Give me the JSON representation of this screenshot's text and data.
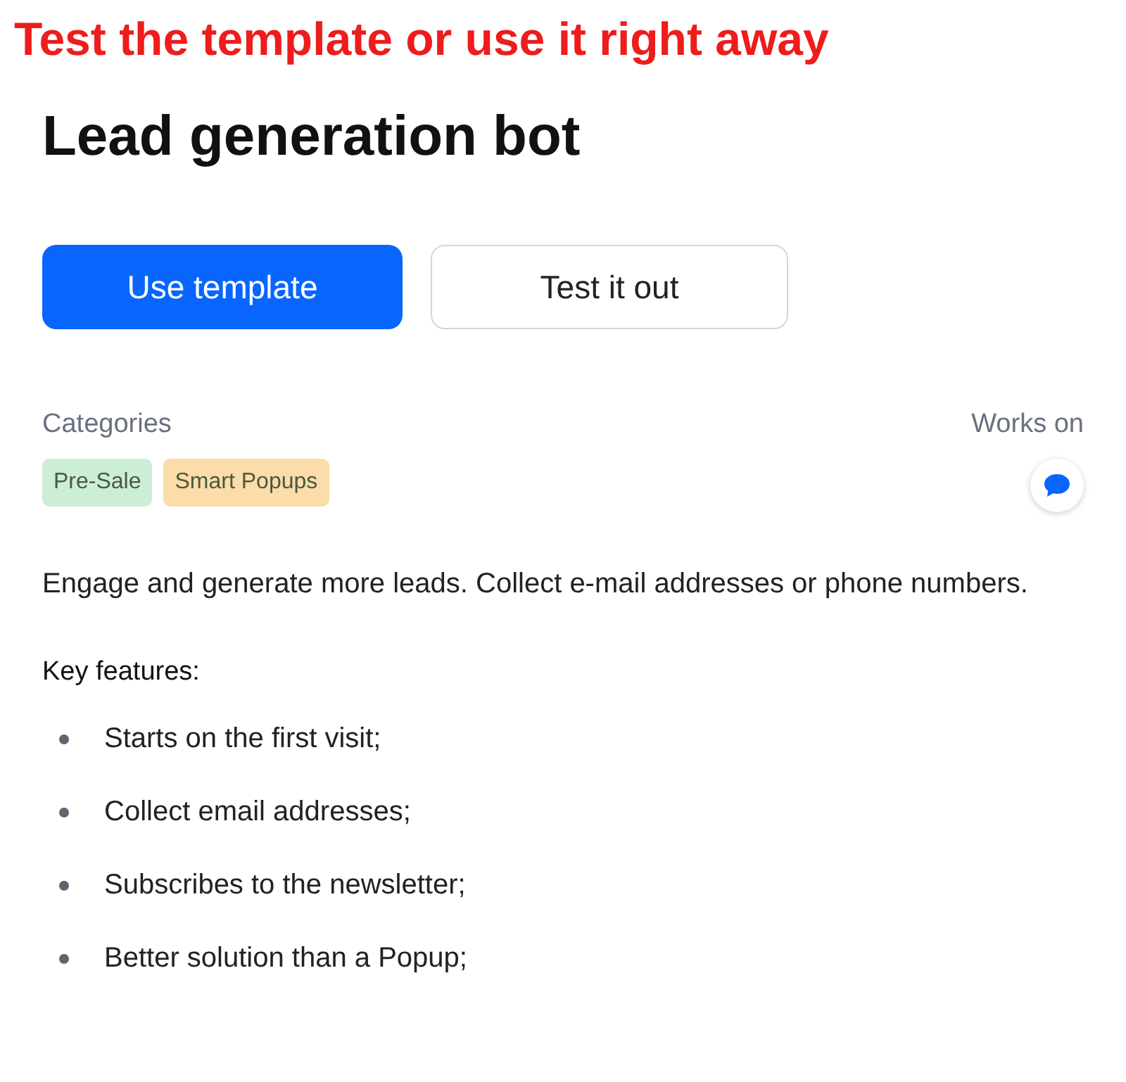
{
  "annotation": "Test the template or use it right away",
  "title": "Lead generation bot",
  "buttons": [
    {
      "label": "Use template",
      "kind": "primary"
    },
    {
      "label": "Test it out",
      "kind": "secondary"
    }
  ],
  "categories": {
    "label": "Categories",
    "tags": [
      {
        "label": "Pre-Sale",
        "color": "#cdeed6"
      },
      {
        "label": "Smart Popups",
        "color": "#fcdca8"
      }
    ]
  },
  "works_on": {
    "label": "Works on"
  },
  "description": "Engage and generate more leads. Collect e-mail addresses or phone numbers.",
  "features": {
    "heading": "Key features:",
    "items": [
      "Starts on the first visit;",
      "Collect email addresses;",
      "Subscribes to the newsletter;",
      "Better solution than a Popup;"
    ]
  }
}
